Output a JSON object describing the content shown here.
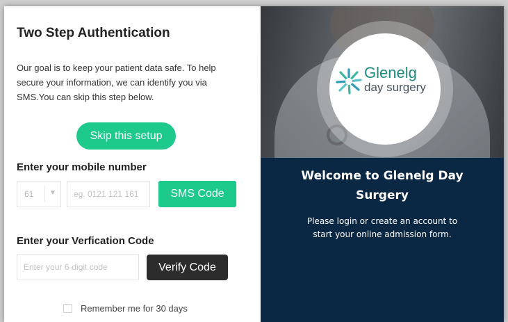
{
  "auth": {
    "title": "Two Step Authentication",
    "description": "Our goal is to keep your patient data safe. To help secure your information, we can identify you via SMS.You can skip this step below.",
    "skip_label": "Skip this setup",
    "mobile_label": "Enter your mobile number",
    "country_code": "61",
    "phone_placeholder": "eg. 0121 121 161",
    "sms_button": "SMS Code",
    "verify_label": "Enter your Verfication Code",
    "code_placeholder": "Enter your 6-digit code",
    "verify_button": "Verify Code",
    "remember_label": "Remember me for 30 days",
    "remember_checked": false
  },
  "brand": {
    "logo_name": "Glenelg",
    "logo_sub": "day surgery",
    "welcome_line1": "Welcome to Glenelg Day",
    "welcome_line2": "Surgery",
    "sub_line1": "Please login or create an account to",
    "sub_line2": "start your online admission form."
  },
  "colors": {
    "accent_green": "#1ec98c",
    "navy_panel": "#0a2744",
    "dark_button": "#2c2c2c",
    "logo_teal": "#1d8a7e"
  },
  "icons": {
    "country_dropdown": "chevron-down-icon",
    "brand_mark": "glenelg-starburst-icon",
    "remember": "checkbox-icon"
  }
}
